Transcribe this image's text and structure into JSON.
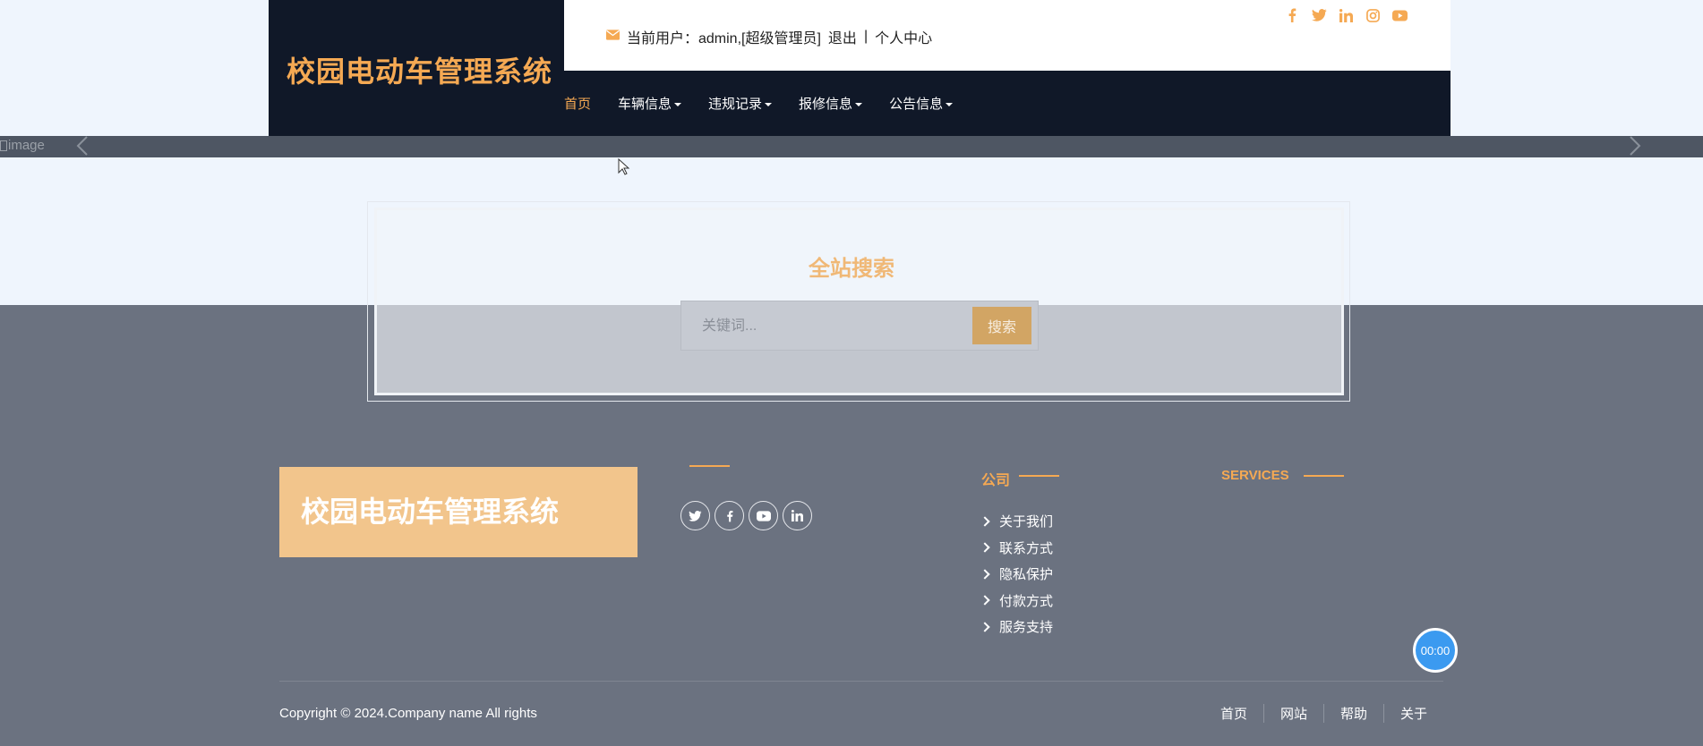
{
  "header": {
    "site_title": "校园电动车管理系统",
    "user_text": "当前用户：admin,[超级管理员]",
    "logout": "退出",
    "separator": "|",
    "profile": "个人中心",
    "social_icons": [
      "facebook-icon",
      "twitter-icon",
      "linkedin-icon",
      "instagram-icon",
      "youtube-icon"
    ]
  },
  "nav": {
    "items": [
      {
        "label": "首页",
        "active": true,
        "dropdown": false
      },
      {
        "label": "车辆信息",
        "active": false,
        "dropdown": true
      },
      {
        "label": "违规记录",
        "active": false,
        "dropdown": true
      },
      {
        "label": "报修信息",
        "active": false,
        "dropdown": true
      },
      {
        "label": "公告信息",
        "active": false,
        "dropdown": true
      }
    ]
  },
  "carousel": {
    "img_alt": "image"
  },
  "search": {
    "title": "全站搜索",
    "placeholder": "关键词...",
    "button": "搜索"
  },
  "footer": {
    "site_title": "校园电动车管理系统",
    "social_icons": [
      "twitter-icon",
      "facebook-icon",
      "youtube-icon",
      "linkedin-icon"
    ],
    "company_title": "公司",
    "services_title": "SERVICES",
    "company_links": [
      "关于我们",
      "联系方式",
      "隐私保护",
      "付款方式",
      "服务支持"
    ],
    "copyright": "Copyright © 2024.Company name All rights",
    "bottom_links": [
      "首页",
      "网站",
      "帮助",
      "关于"
    ]
  },
  "timer": "00:00",
  "colors": {
    "accent": "#f5a953",
    "dark": "#101828",
    "footer_bg": "#6b7280"
  }
}
